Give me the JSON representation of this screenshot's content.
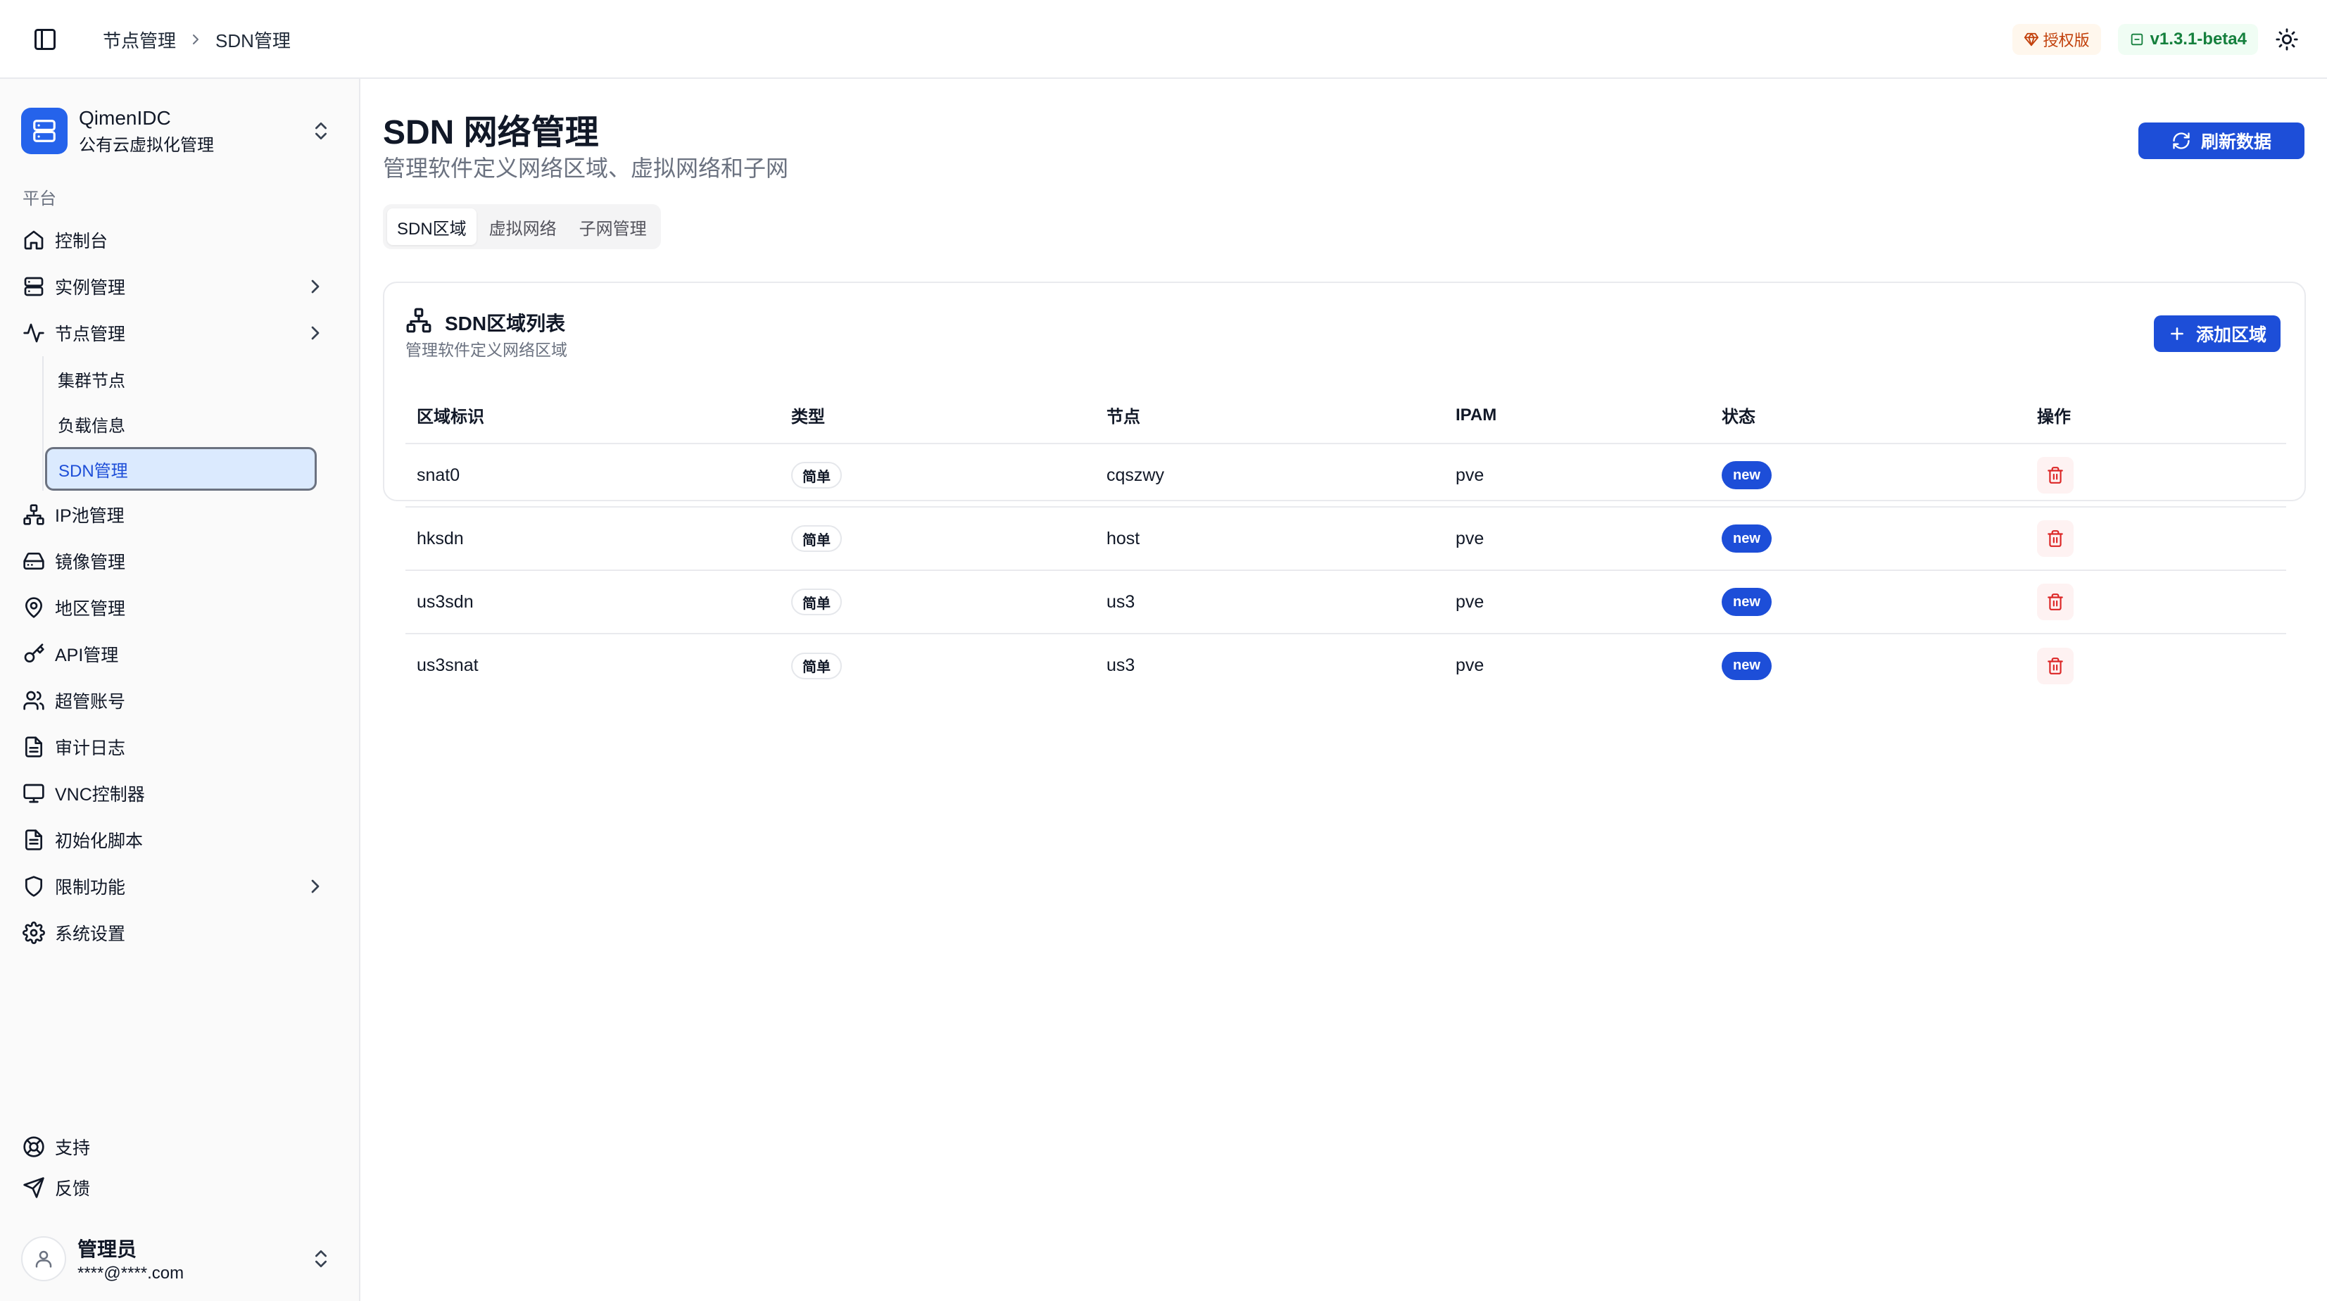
{
  "header": {
    "breadcrumb": [
      "节点管理",
      "SDN管理"
    ],
    "license_label": "授权版",
    "version": "v1.3.1-beta4"
  },
  "sidebar": {
    "org": {
      "name": "QimenIDC",
      "subtitle": "公有云虚拟化管理"
    },
    "group_label": "平台",
    "items": [
      {
        "label": "控制台",
        "icon": "home-icon"
      },
      {
        "label": "实例管理",
        "icon": "server-icon",
        "expandable": true
      },
      {
        "label": "节点管理",
        "icon": "activity-icon",
        "expandable": true,
        "children": [
          {
            "label": "集群节点"
          },
          {
            "label": "负载信息"
          },
          {
            "label": "SDN管理",
            "active": true
          }
        ]
      },
      {
        "label": "IP池管理",
        "icon": "network-icon"
      },
      {
        "label": "镜像管理",
        "icon": "hard-drive-icon"
      },
      {
        "label": "地区管理",
        "icon": "map-pin-icon"
      },
      {
        "label": "API管理",
        "icon": "key-icon"
      },
      {
        "label": "超管账号",
        "icon": "users-icon"
      },
      {
        "label": "审计日志",
        "icon": "file-text-icon"
      },
      {
        "label": "VNC控制器",
        "icon": "monitor-icon"
      },
      {
        "label": "初始化脚本",
        "icon": "file-code-icon"
      },
      {
        "label": "限制功能",
        "icon": "shield-icon",
        "expandable": true
      },
      {
        "label": "系统设置",
        "icon": "settings-icon"
      }
    ],
    "bottom_items": [
      {
        "label": "支持",
        "icon": "life-buoy-icon"
      },
      {
        "label": "反馈",
        "icon": "send-icon"
      }
    ],
    "user": {
      "name": "管理员",
      "email": "****@****.com"
    }
  },
  "main": {
    "title": "SDN 网络管理",
    "subtitle": "管理软件定义网络区域、虚拟网络和子网",
    "refresh_label": "刷新数据",
    "tabs": [
      {
        "label": "SDN区域",
        "active": true
      },
      {
        "label": "虚拟网络"
      },
      {
        "label": "子网管理"
      }
    ],
    "card": {
      "title": "SDN区域列表",
      "subtitle": "管理软件定义网络区域",
      "add_label": "添加区域",
      "columns": [
        "区域标识",
        "类型",
        "节点",
        "IPAM",
        "状态",
        "操作"
      ],
      "rows": [
        {
          "id": "snat0",
          "type": "简单",
          "node": "cqszwy",
          "ipam": "pve",
          "status": "new"
        },
        {
          "id": "hksdn",
          "type": "简单",
          "node": "host",
          "ipam": "pve",
          "status": "new"
        },
        {
          "id": "us3sdn",
          "type": "简单",
          "node": "us3",
          "ipam": "pve",
          "status": "new"
        },
        {
          "id": "us3snat",
          "type": "简单",
          "node": "us3",
          "ipam": "pve",
          "status": "new"
        }
      ]
    }
  },
  "colors": {
    "primary": "#1d4ed8",
    "active_bg": "#dbeafe",
    "danger": "#dc2626",
    "license": "#c2410c",
    "version": "#15803d"
  }
}
